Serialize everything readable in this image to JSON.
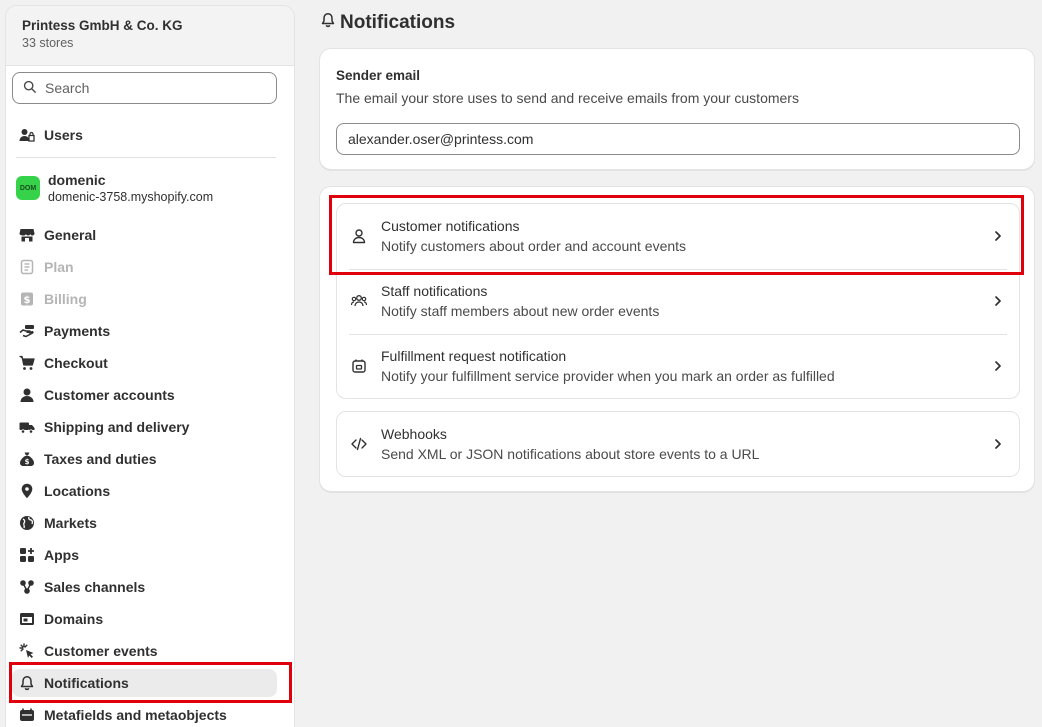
{
  "sidebar": {
    "org_name": "Printess GmbH & Co. KG",
    "org_count": "33 stores",
    "search_placeholder": "Search",
    "users_label": "Users",
    "store": {
      "avatar_text": "DOM",
      "name": "domenic",
      "domain": "domenic-3758.myshopify.com"
    },
    "items": [
      {
        "label": "General",
        "icon": "store-icon"
      },
      {
        "label": "Plan",
        "icon": "plan-icon"
      },
      {
        "label": "Billing",
        "icon": "billing-icon"
      },
      {
        "label": "Payments",
        "icon": "payments-icon"
      },
      {
        "label": "Checkout",
        "icon": "cart-icon"
      },
      {
        "label": "Customer accounts",
        "icon": "person-icon"
      },
      {
        "label": "Shipping and delivery",
        "icon": "truck-icon"
      },
      {
        "label": "Taxes and duties",
        "icon": "money-bag-icon"
      },
      {
        "label": "Locations",
        "icon": "location-pin-icon"
      },
      {
        "label": "Markets",
        "icon": "globe-icon"
      },
      {
        "label": "Apps",
        "icon": "apps-icon"
      },
      {
        "label": "Sales channels",
        "icon": "sales-channels-icon"
      },
      {
        "label": "Domains",
        "icon": "domains-icon"
      },
      {
        "label": "Customer events",
        "icon": "cursor-click-icon"
      },
      {
        "label": "Notifications",
        "icon": "bell-icon"
      },
      {
        "label": "Metafields and metaobjects",
        "icon": "metafields-icon"
      }
    ]
  },
  "main": {
    "title": "Notifications",
    "sender": {
      "title": "Sender email",
      "description": "The email your store uses to send and receive emails from your customers",
      "value": "alexander.oser@printess.com"
    },
    "notification_rows": [
      {
        "title": "Customer notifications",
        "description": "Notify customers about order and account events",
        "icon": "person-icon"
      },
      {
        "title": "Staff notifications",
        "description": "Notify staff members about new order events",
        "icon": "people-icon"
      },
      {
        "title": "Fulfillment request notification",
        "description": "Notify your fulfillment service provider when you mark an order as fulfilled",
        "icon": "package-icon"
      }
    ],
    "webhooks": {
      "title": "Webhooks",
      "description": "Send XML or JSON notifications about store events to a URL",
      "icon": "code-icon"
    }
  },
  "colors": {
    "highlight": "#e0000b",
    "store_avatar": "#36d34a",
    "page_bg": "#f1f1f1"
  }
}
